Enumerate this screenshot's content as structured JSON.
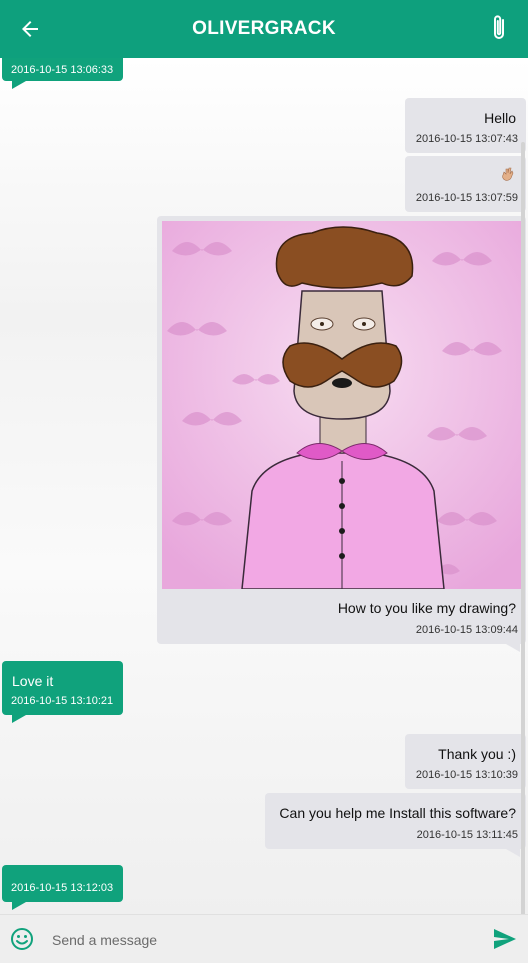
{
  "header": {
    "title": "OLIVERGRACK"
  },
  "messages": [
    {
      "side": "in",
      "time": "2016-10-15 13:06:33"
    },
    {
      "side": "out",
      "text": "Hello",
      "time": "2016-10-15 13:07:43"
    },
    {
      "side": "out",
      "emoji": "hand-emoji",
      "time": "2016-10-15 13:07:59"
    },
    {
      "side": "out",
      "text": "How to you like my drawing?",
      "time": "2016-10-15 13:09:44"
    },
    {
      "side": "in",
      "text": "Love it",
      "time": "2016-10-15 13:10:21"
    },
    {
      "side": "out",
      "text": "Thank you :)",
      "time": "2016-10-15 13:10:39"
    },
    {
      "side": "out",
      "text": "Can you help me Install this software?",
      "time": "2016-10-15 13:11:45"
    },
    {
      "side": "in",
      "time": "2016-10-15 13:12:03"
    }
  ],
  "composer": {
    "placeholder": "Send a message"
  },
  "colors": {
    "accent": "#0ea07d",
    "incoming": "#10a27c",
    "outgoing": "#e4e4e9"
  }
}
